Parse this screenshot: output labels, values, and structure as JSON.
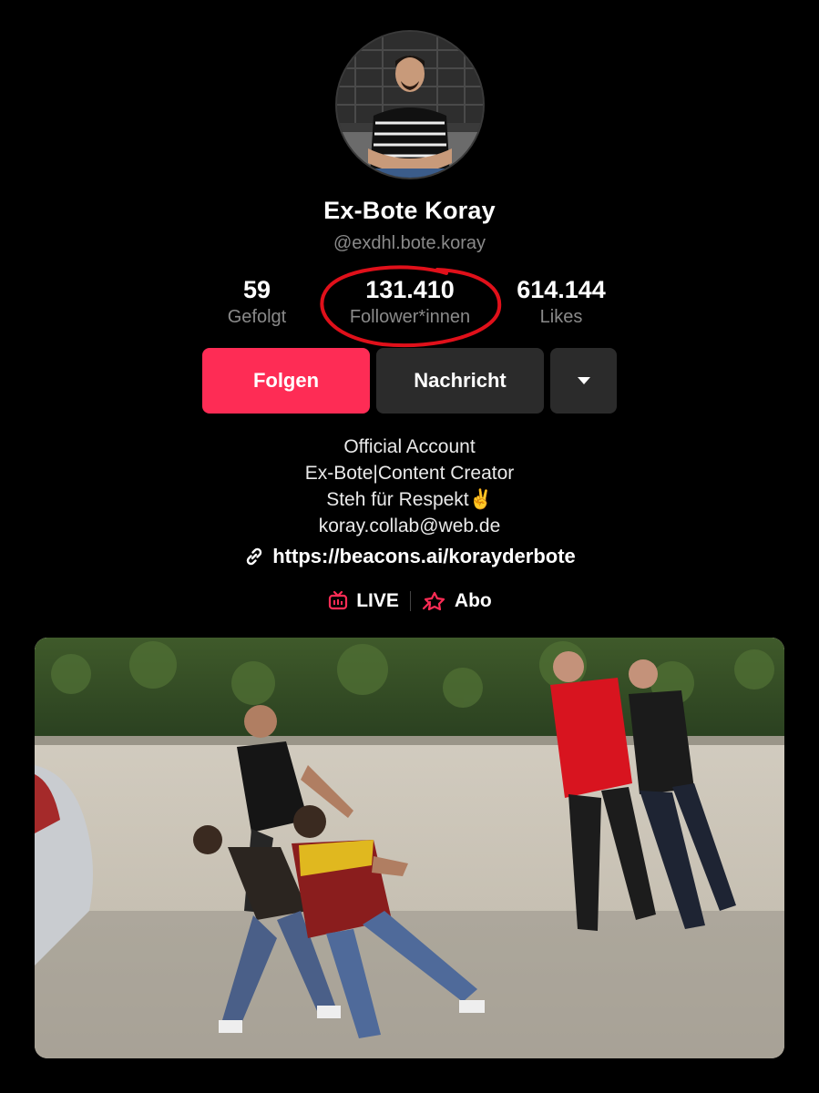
{
  "profile": {
    "display_name": "Ex-Bote Koray",
    "username": "@exdhl.bote.koray"
  },
  "stats": {
    "following": {
      "value": "59",
      "label": "Gefolgt"
    },
    "followers": {
      "value": "131.410",
      "label": "Follower*innen"
    },
    "likes": {
      "value": "614.144",
      "label": "Likes"
    }
  },
  "buttons": {
    "follow": "Folgen",
    "message": "Nachricht"
  },
  "bio": {
    "line1": "Official Account",
    "line2": "Ex-Bote|Content Creator",
    "line3": "Steh für Respekt✌️",
    "line4": "koray.collab@web.de"
  },
  "link": {
    "url": "https://beacons.ai/korayderbote"
  },
  "tags": {
    "live": "LIVE",
    "abo": "Abo"
  },
  "colors": {
    "accent": "#fe2c55",
    "annotation": "#e0101a",
    "button_dark": "#2b2b2b",
    "muted_text": "#8a8a8a"
  },
  "icons": [
    "link-icon",
    "live-icon",
    "abo-icon",
    "caret-down-icon"
  ]
}
